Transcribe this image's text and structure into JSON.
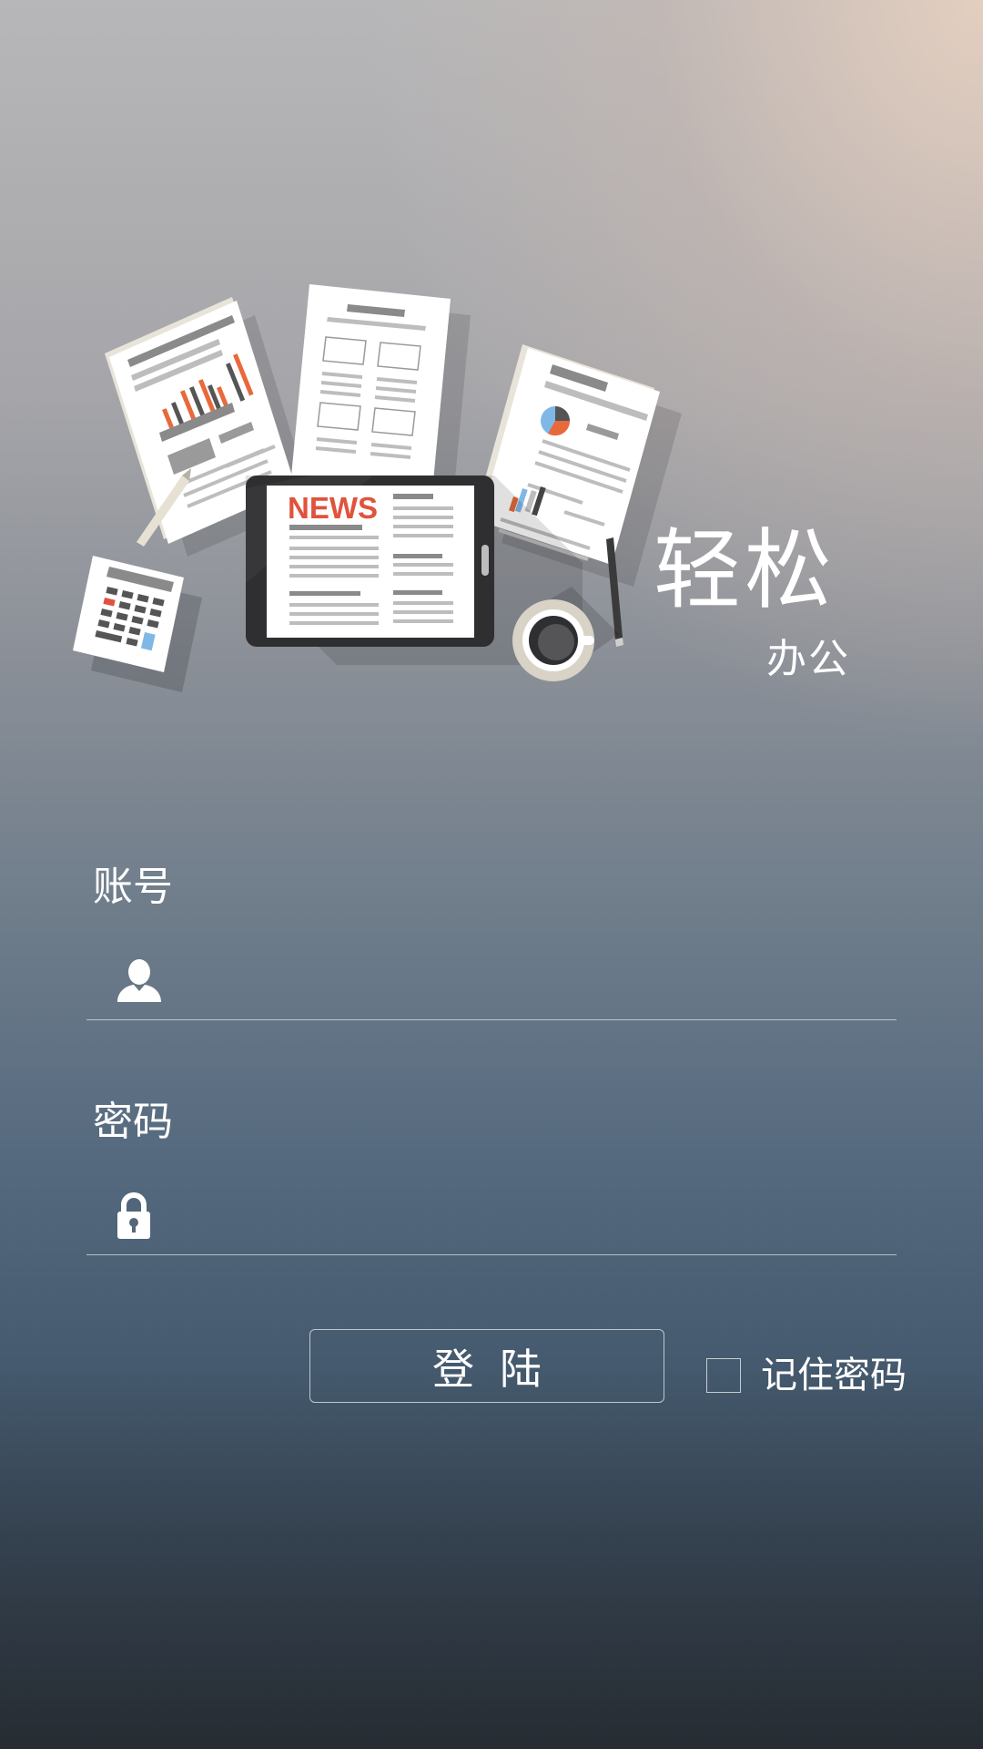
{
  "brand": {
    "title": "轻松",
    "subtitle": "办公",
    "hero_headline": "NEWS"
  },
  "form": {
    "account": {
      "label": "账号",
      "icon": "user-icon",
      "value": ""
    },
    "password": {
      "label": "密码",
      "icon": "lock-icon",
      "value": ""
    },
    "login_label": "登陆",
    "remember": {
      "label": "记住密码",
      "checked": false
    }
  },
  "colors": {
    "news_red": "#e0533c",
    "tablet_dark": "#2f2f31",
    "chart_orange": "#e8693a",
    "chart_blue": "#7fb8e6"
  }
}
